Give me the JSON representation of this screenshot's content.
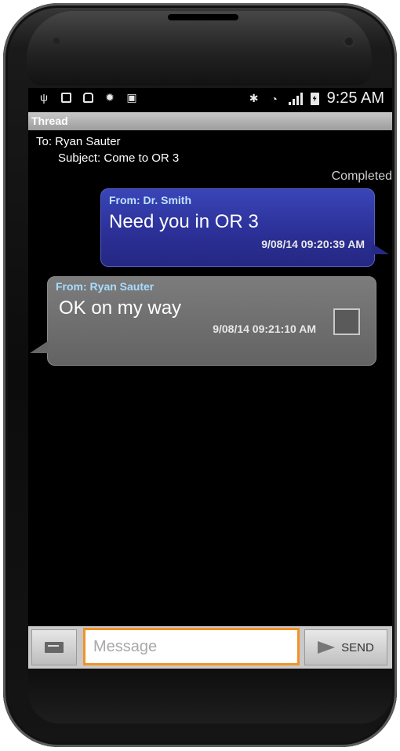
{
  "statusbar": {
    "time": "9:25 AM",
    "left_icons": [
      "usb-icon",
      "image-icon",
      "clipboard-icon",
      "android-icon",
      "bag-icon"
    ],
    "right_icons": [
      "bluetooth-icon",
      "wifi-icon",
      "signal-icon",
      "battery-icon"
    ]
  },
  "header": {
    "title": "Thread"
  },
  "thread": {
    "to": "To: Ryan Sauter",
    "subject": "Subject: Come to OR 3",
    "status": "Completed"
  },
  "messages": [
    {
      "from": "From: Dr. Smith",
      "text": "Need you in OR 3",
      "timestamp": "9/08/14  09:20:39 AM",
      "direction": "outgoing",
      "color": "#2b2f95"
    },
    {
      "from": "From: Ryan Sauter",
      "text": "OK on my way",
      "timestamp": "9/08/14  09:21:10 AM",
      "direction": "incoming",
      "color": "#6b6b6b",
      "checked": false
    }
  ],
  "composer": {
    "placeholder": "Message",
    "value": "",
    "send_label": "SEND",
    "accent": "#f0922a"
  }
}
